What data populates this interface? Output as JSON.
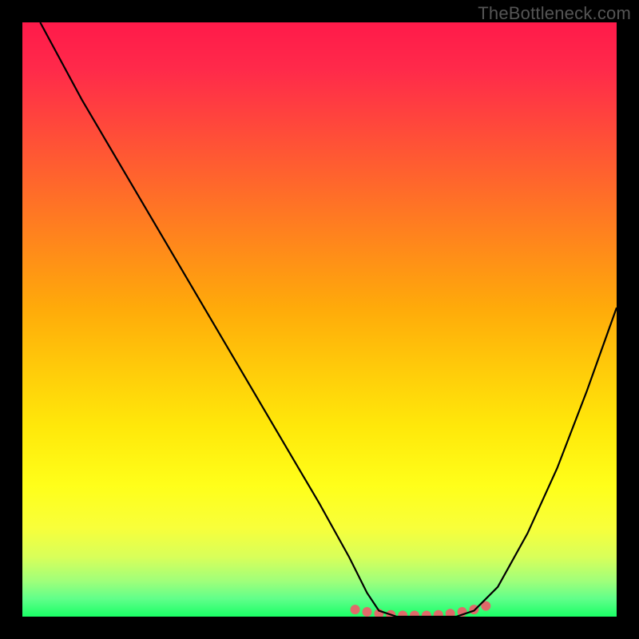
{
  "watermark": "TheBottleneck.com",
  "chart_data": {
    "type": "line",
    "title": "",
    "xlabel": "",
    "ylabel": "",
    "xlim": [
      0,
      100
    ],
    "ylim": [
      0,
      100
    ],
    "grid": false,
    "legend": false,
    "background_gradient": {
      "top": "#ff1a4a",
      "middle": "#ffe80a",
      "bottom": "#1aff66"
    },
    "series": [
      {
        "name": "bottleneck-curve",
        "color": "#000000",
        "x": [
          3,
          10,
          20,
          30,
          40,
          50,
          55,
          58,
          60,
          63,
          66,
          70,
          73,
          76,
          80,
          85,
          90,
          95,
          100
        ],
        "values": [
          100,
          87,
          70,
          53,
          36,
          19,
          10,
          4,
          1,
          0,
          0,
          0,
          0,
          1,
          5,
          14,
          25,
          38,
          52
        ]
      }
    ],
    "markers": {
      "name": "optimal-range-dots",
      "color": "#e06a6a",
      "radius": 6,
      "x": [
        56,
        58,
        60,
        62,
        64,
        66,
        68,
        70,
        72,
        74,
        76,
        78
      ],
      "values": [
        1.2,
        0.8,
        0.5,
        0.3,
        0.2,
        0.2,
        0.2,
        0.3,
        0.5,
        0.8,
        1.2,
        1.8
      ]
    }
  }
}
